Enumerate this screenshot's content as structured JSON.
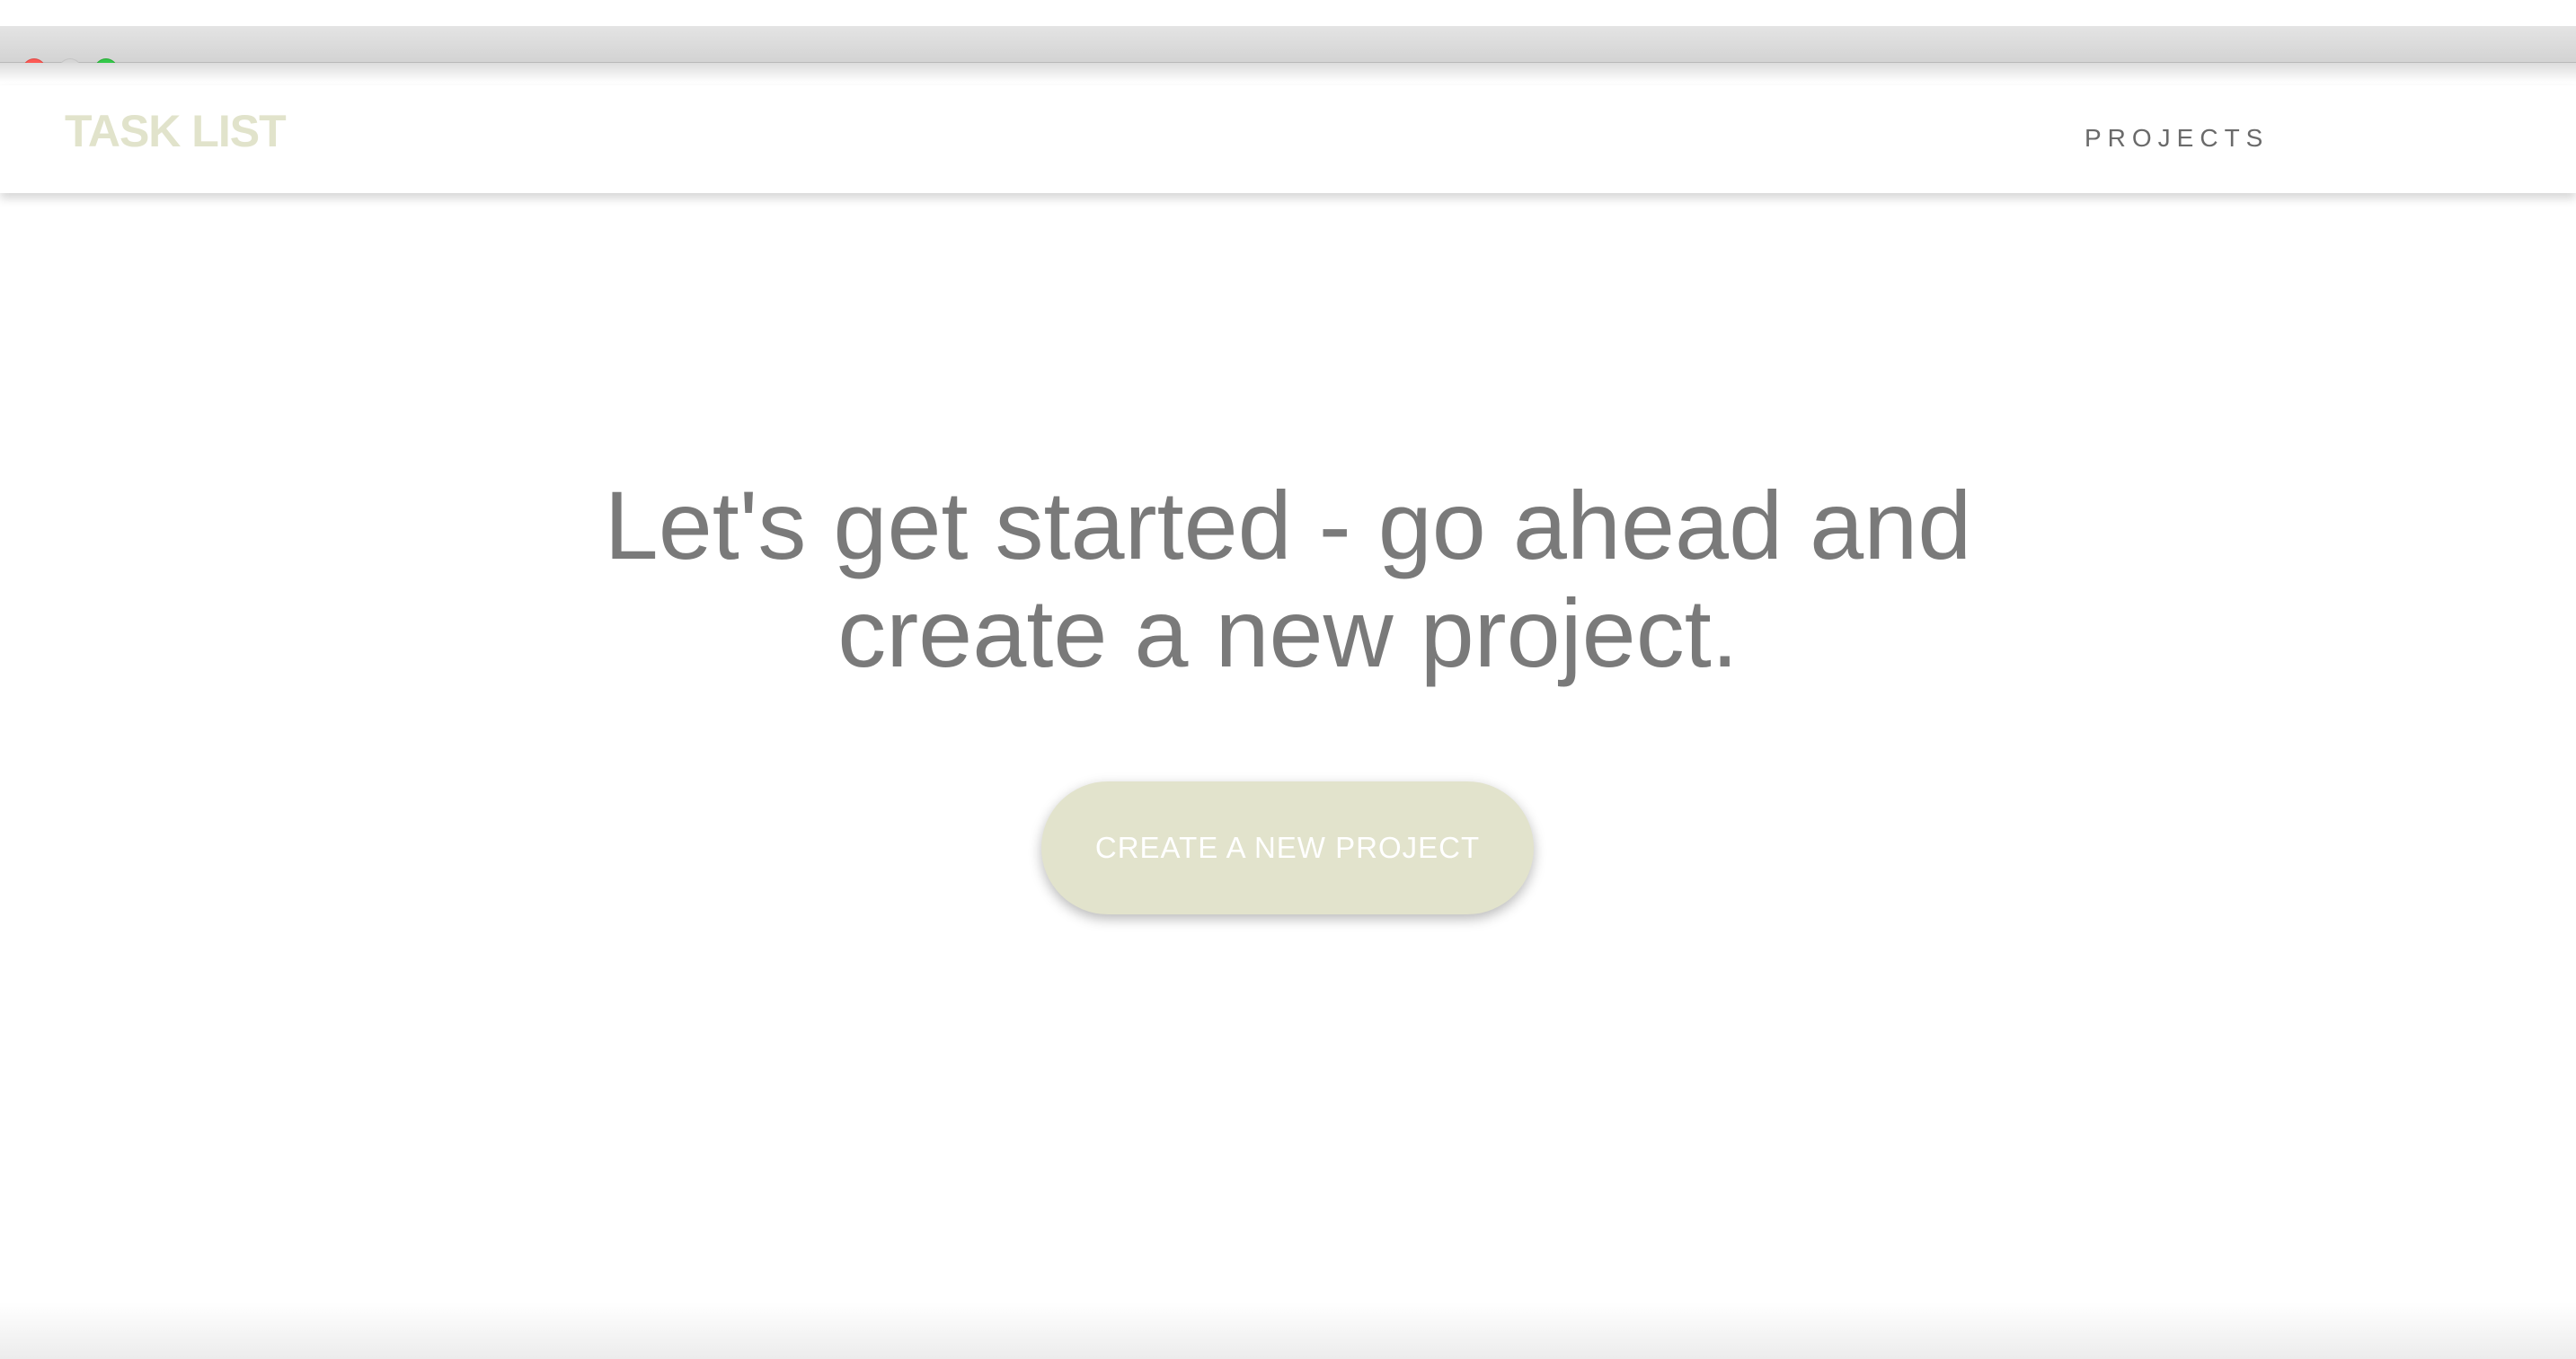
{
  "window": {
    "controls": {
      "close": "close-icon",
      "minimize": "minimize-icon",
      "zoom": "zoom-icon"
    }
  },
  "navbar": {
    "brand": "TASK LIST",
    "links": [
      "PROJECTS"
    ]
  },
  "hero": {
    "title_line1": "Let's get started - go ahead and",
    "title_line2": "create a new project."
  },
  "cta": {
    "label": "CREATE A NEW PROJECT"
  },
  "colors": {
    "accent": "#e2e3cc",
    "brand": "#e1e3cb",
    "text": "#7a7a7a",
    "nav_text": "#6a6a6a",
    "close": "#fc5a55",
    "minimize": "#d6d6d6",
    "zoom": "#34c84a"
  }
}
